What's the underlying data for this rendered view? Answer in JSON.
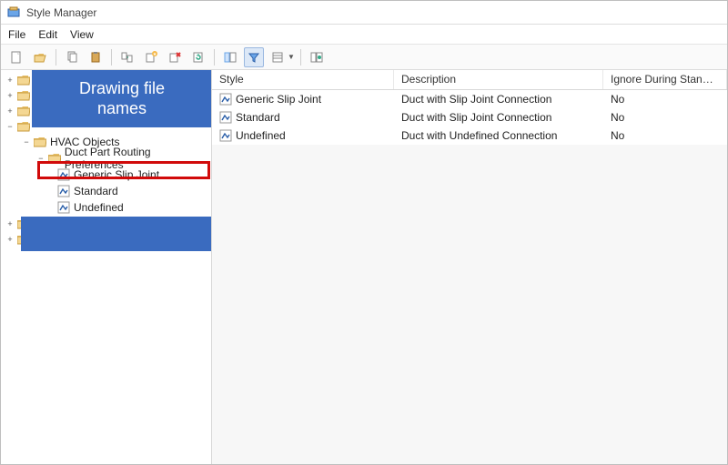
{
  "window": {
    "title": "Style Manager"
  },
  "menu": {
    "file": "File",
    "edit": "Edit",
    "view": "View"
  },
  "overlay": {
    "drawing_files": "Drawing file\nnames"
  },
  "tree": {
    "hvac_objects": "HVAC Objects",
    "dpr": "Duct Part Routing Preferences",
    "leaves": [
      {
        "label": "Generic Slip Joint"
      },
      {
        "label": "Standard"
      },
      {
        "label": "Undefined"
      }
    ]
  },
  "list": {
    "columns": {
      "style": "Style",
      "description": "Description",
      "ignore": "Ignore During Standards Synchro..."
    },
    "rows": [
      {
        "style": "Generic Slip Joint",
        "description": "Duct with Slip Joint Connection",
        "ignore": "No"
      },
      {
        "style": "Standard",
        "description": "Duct with Slip Joint Connection",
        "ignore": "No"
      },
      {
        "style": "Undefined",
        "description": "Duct with Undefined Connection",
        "ignore": "No"
      }
    ]
  }
}
